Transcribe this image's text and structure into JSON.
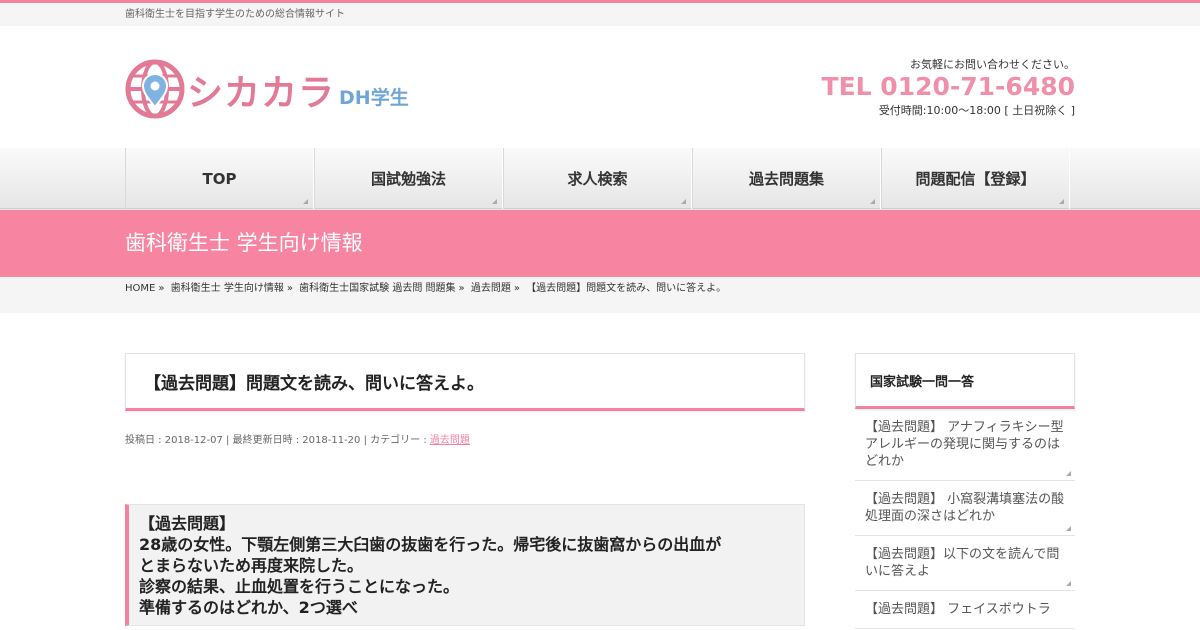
{
  "site": {
    "tagline": "歯科衛生士を目指す学生のための総合情報サイト",
    "logo_main": "シカカラ",
    "logo_sub": "DH学生",
    "contact_lead": "お気軽にお問い合わせください。",
    "tel": "TEL 0120-71-6480",
    "hours": "受付時間:10:00～18:00 [ 土日祝除く ]"
  },
  "nav": [
    "TOP",
    "国試勉強法",
    "求人検索",
    "過去問題集",
    "問題配信【登録】"
  ],
  "category_title": "歯科衛生士 学生向け情報",
  "breadcrumb": [
    "HOME",
    "歯科衛生士 学生向け情報",
    "歯科衛生士国家試験 過去問 問題集",
    "過去問題",
    "【過去問題】問題文を読み、問いに答えよ。"
  ],
  "post": {
    "title": "【過去問題】問題文を読み、問いに答えよ。",
    "meta_prefix": "投稿日 : 2018-12-07 | 最終更新日時 : 2018-11-20 | カテゴリー : ",
    "category": "過去問題",
    "question_lines": [
      "【過去問題】",
      "28歳の女性。下顎左側第三大臼歯の抜歯を行った。帰宅後に抜歯窩からの出血が",
      "とまらないため再度来院した。",
      "診察の結果、止血処置を行うことになった。",
      "準備するのはどれか、2つ選べ"
    ]
  },
  "sidebar": {
    "heading": "国家試験一問一答",
    "items": [
      "【過去問題】 アナフィラキシー型アレルギーの発現に関与するのはどれか",
      "【過去問題】 小窩裂溝填塞法の酸処理面の深さはどれか",
      "【過去問題】以下の文を読んで問いに答えよ",
      "【過去問題】 フェイスボウトラ"
    ]
  },
  "colors": {
    "accent": "#f3829f",
    "band": "#f784a1",
    "logo_pink": "#e27a96",
    "logo_blue": "#6fa6d8"
  }
}
